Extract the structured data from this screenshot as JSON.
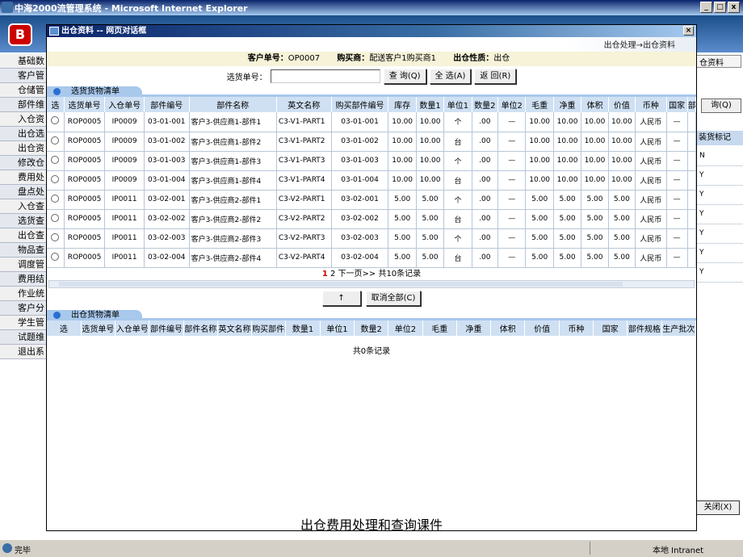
{
  "window_title": "中海2000流管理系统 - Microsoft Internet Explorer",
  "win_buttons": [
    "_",
    "□",
    "x"
  ],
  "app_logo": "B",
  "left_menu": [
    "基础数",
    "客户管",
    "仓储管",
    "部件维",
    "入仓资",
    "出仓选",
    "出仓资",
    "修改仓",
    "费用处",
    "盘点处",
    "入仓查",
    "选货查",
    "出仓查",
    "物品查",
    "调度管",
    "费用结",
    "作业统",
    "客户分",
    "学生管",
    "试题维",
    "退出系"
  ],
  "right_pane": {
    "tab": "仓资料",
    "query_btn": "询(Q)",
    "header": "装货标记",
    "rows": [
      "N",
      "Y",
      "Y",
      "Y",
      "Y",
      "Y",
      "Y"
    ],
    "close_btn": "关闭(X)"
  },
  "dialog": {
    "title": "出仓资料 -- 网页对话框",
    "close": "×",
    "breadcrumb": "出仓处理→出仓资料",
    "customer_label": "客户单号：",
    "customer_value": "OP0007",
    "buyer_label": "购买商：",
    "buyer_value": "配送客户1购买商1",
    "nature_label": "出仓性质：",
    "nature_value": "出仓",
    "pick_label": "选货单号：",
    "btn_query": "查 询(Q)",
    "btn_all": "全 选(A)",
    "btn_back": "返 回(R)",
    "section1": "选货货物清单",
    "cols1": [
      "选",
      "选货单号",
      "入仓单号",
      "部件编号",
      "部件名称",
      "英文名称",
      "购买部件编号",
      "库存",
      "数量1",
      "单位1",
      "数量2",
      "单位2",
      "毛重",
      "净重",
      "体积",
      "价值",
      "币种",
      "国家",
      "部"
    ],
    "rows1": [
      [
        "ROP0005",
        "IP0009",
        "03-01-001",
        "客户3-供应商1-部件1",
        "C3-V1-PART1",
        "03-01-001",
        "10.00",
        "10.00",
        "个",
        ".00",
        "—",
        "10.00",
        "10.00",
        "10.00",
        "10.00",
        "人民币",
        "—"
      ],
      [
        "ROP0005",
        "IP0009",
        "03-01-002",
        "客户3-供应商1-部件2",
        "C3-V1-PART2",
        "03-01-002",
        "10.00",
        "10.00",
        "台",
        ".00",
        "—",
        "10.00",
        "10.00",
        "10.00",
        "10.00",
        "人民币",
        "—"
      ],
      [
        "ROP0005",
        "IP0009",
        "03-01-003",
        "客户3-供应商1-部件3",
        "C3-V1-PART3",
        "03-01-003",
        "10.00",
        "10.00",
        "个",
        ".00",
        "—",
        "10.00",
        "10.00",
        "10.00",
        "10.00",
        "人民币",
        "—"
      ],
      [
        "ROP0005",
        "IP0009",
        "03-01-004",
        "客户3-供应商1-部件4",
        "C3-V1-PART4",
        "03-01-004",
        "10.00",
        "10.00",
        "台",
        ".00",
        "—",
        "10.00",
        "10.00",
        "10.00",
        "10.00",
        "人民币",
        "—"
      ],
      [
        "ROP0005",
        "IP0011",
        "03-02-001",
        "客户3-供应商2-部件1",
        "C3-V2-PART1",
        "03-02-001",
        "5.00",
        "5.00",
        "个",
        ".00",
        "—",
        "5.00",
        "5.00",
        "5.00",
        "5.00",
        "人民币",
        "—"
      ],
      [
        "ROP0005",
        "IP0011",
        "03-02-002",
        "客户3-供应商2-部件2",
        "C3-V2-PART2",
        "03-02-002",
        "5.00",
        "5.00",
        "台",
        ".00",
        "—",
        "5.00",
        "5.00",
        "5.00",
        "5.00",
        "人民币",
        "—"
      ],
      [
        "ROP0005",
        "IP0011",
        "03-02-003",
        "客户3-供应商2-部件3",
        "C3-V2-PART3",
        "03-02-003",
        "5.00",
        "5.00",
        "个",
        ".00",
        "—",
        "5.00",
        "5.00",
        "5.00",
        "5.00",
        "人民币",
        "—"
      ],
      [
        "ROP0005",
        "IP0011",
        "03-02-004",
        "客户3-供应商2-部件4",
        "C3-V2-PART4",
        "03-02-004",
        "5.00",
        "5.00",
        "台",
        ".00",
        "—",
        "5.00",
        "5.00",
        "5.00",
        "5.00",
        "人民币",
        "—"
      ]
    ],
    "pager_current": "1",
    "pager_rest": "2 下一页>> 共10条记录",
    "btn_up": "↑",
    "btn_cancel_all": "取消全部(C)",
    "section2": "出仓货物清单",
    "cols2": [
      "选",
      "选货单号",
      "入仓单号",
      "部件编号",
      "部件名称",
      "英文名称",
      "购买部件编号",
      "数量1",
      "单位1",
      "数量2",
      "单位2",
      "毛重",
      "净重",
      "体积",
      "价值",
      "币种",
      "国家",
      "部件规格",
      "生产批次"
    ],
    "empty_text": "共0条记录",
    "caption": "出仓费用处理和查询课件"
  },
  "status": {
    "left": "完毕",
    "zone": "本地 Intranet"
  }
}
